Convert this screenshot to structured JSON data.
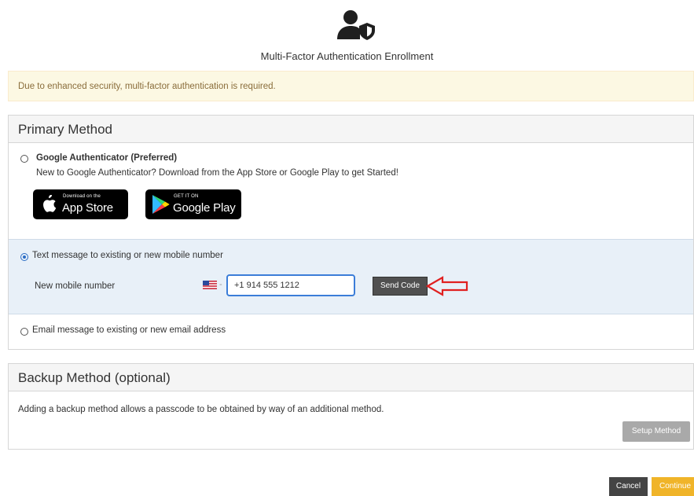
{
  "header": {
    "title": "Multi-Factor Authentication Enrollment",
    "icon": "user-shield-icon"
  },
  "alert": {
    "message": "Due to enhanced security, multi-factor authentication is required."
  },
  "primary": {
    "heading": "Primary Method",
    "google": {
      "label": "Google Authenticator (Preferred)",
      "description": "New to Google Authenticator? Download from the App Store or Google Play to get Started!",
      "selected": false,
      "app_store": {
        "small": "Download on the",
        "big": "App Store"
      },
      "google_play": {
        "small": "GET IT ON",
        "big": "Google Play"
      }
    },
    "text_message": {
      "label": "Text message to existing or new mobile number",
      "selected": true,
      "field_label": "New mobile number",
      "phone_value": "+1 914 555 1212",
      "country_flag": "us-flag-icon",
      "send_button": "Send Code"
    },
    "email": {
      "label": "Email message to existing or new email address",
      "selected": false
    }
  },
  "backup": {
    "heading": "Backup Method (optional)",
    "description": "Adding a backup method allows a passcode to be obtained by way of an additional method.",
    "setup_button": "Setup Method"
  },
  "footer": {
    "cancel": "Cancel",
    "continue": "Continue"
  },
  "colors": {
    "alert_bg": "#fcf8e3",
    "alert_text": "#8a6d3b",
    "selected_bg": "#e8f0f8",
    "continue": "#f0b429",
    "annotation_arrow": "#e02020"
  }
}
